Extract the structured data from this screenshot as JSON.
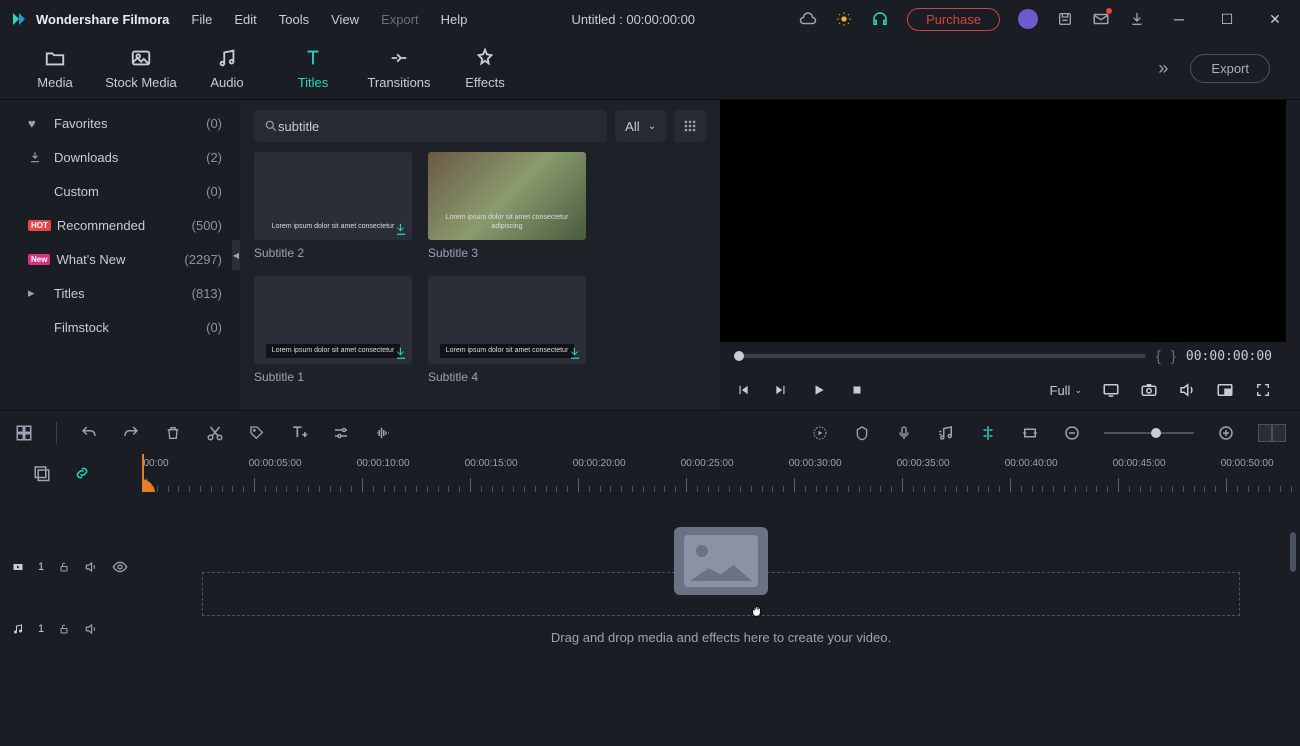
{
  "titlebar": {
    "app_name": "Wondershare Filmora",
    "menu": [
      "File",
      "Edit",
      "Tools",
      "View",
      "Export",
      "Help"
    ],
    "disabled_menu_index": 4,
    "project_title": "Untitled : 00:00:00:00",
    "purchase_label": "Purchase"
  },
  "tabs": {
    "items": [
      {
        "label": "Media",
        "icon": "folder-icon"
      },
      {
        "label": "Stock Media",
        "icon": "image-icon"
      },
      {
        "label": "Audio",
        "icon": "music-icon"
      },
      {
        "label": "Titles",
        "icon": "text-icon"
      },
      {
        "label": "Transitions",
        "icon": "transitions-icon"
      },
      {
        "label": "Effects",
        "icon": "effects-icon"
      }
    ],
    "active_index": 3,
    "export_label": "Export"
  },
  "sidebar": {
    "items": [
      {
        "icon": "heart",
        "label": "Favorites",
        "count": "(0)"
      },
      {
        "icon": "download",
        "label": "Downloads",
        "count": "(2)"
      },
      {
        "icon": "",
        "label": "Custom",
        "count": "(0)",
        "indent": true
      },
      {
        "badge": "HOT",
        "label": "Recommended",
        "count": "(500)"
      },
      {
        "badge": "New",
        "label": "What's New",
        "count": "(2297)"
      },
      {
        "icon": "caret",
        "label": "Titles",
        "count": "(813)"
      },
      {
        "icon": "",
        "label": "Filmstock",
        "count": "(0)",
        "indent": true
      }
    ]
  },
  "browser": {
    "search_value": "subtitle",
    "filter_label": "All",
    "thumbs": [
      {
        "label": "Subtitle 2",
        "variant": "plain"
      },
      {
        "label": "Subtitle 3",
        "variant": "photo"
      },
      {
        "label": "Subtitle 1",
        "variant": "bar"
      },
      {
        "label": "Subtitle 4",
        "variant": "bar"
      }
    ]
  },
  "preview": {
    "timecode": "00:00:00:00",
    "quality_label": "Full"
  },
  "ruler": {
    "labels": [
      "00:00",
      "00:00:05:00",
      "00:00:10:00",
      "00:00:15:00",
      "00:00:20:00",
      "00:00:25:00",
      "00:00:30:00",
      "00:00:35:00",
      "00:00:40:00",
      "00:00:45:00",
      "00:00:50:00"
    ]
  },
  "tracks": {
    "video_num": "1",
    "audio_num": "1",
    "drop_text": "Drag and drop media and effects here to create your video."
  }
}
